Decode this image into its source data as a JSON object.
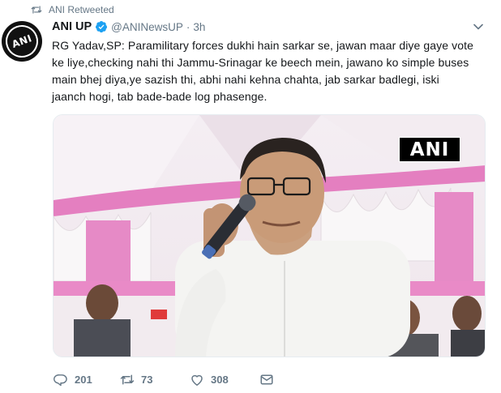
{
  "retweet_context": {
    "icon": "retweet-icon",
    "text": "ANI Retweeted"
  },
  "author": {
    "avatar_text": "ANI",
    "display_name": "ANI UP",
    "verified": true,
    "handle": "@ANINewsUP",
    "separator": "·",
    "time": "3h"
  },
  "tweet": {
    "lines": [
      "RG Yadav,SP: Paramilitary forces dukhi hain sarkar se, jawan maar diye gaye vote",
      "ke liye,checking nahi thi Jammu-Srinagar ke beech mein, jawano ko simple buses",
      "main bhej diya,ye sazish thi,  abhi nahi kehna chahta, jab sarkar badlegi, iski",
      "jaanch hogi, tab bade-bade log phasenge."
    ]
  },
  "media": {
    "watermark": "ANI"
  },
  "actions": {
    "reply_count": "201",
    "retweet_count": "73",
    "like_count": "308"
  },
  "colors": {
    "verified": "#1da1f2",
    "muted": "#657786",
    "text": "#14171a"
  }
}
